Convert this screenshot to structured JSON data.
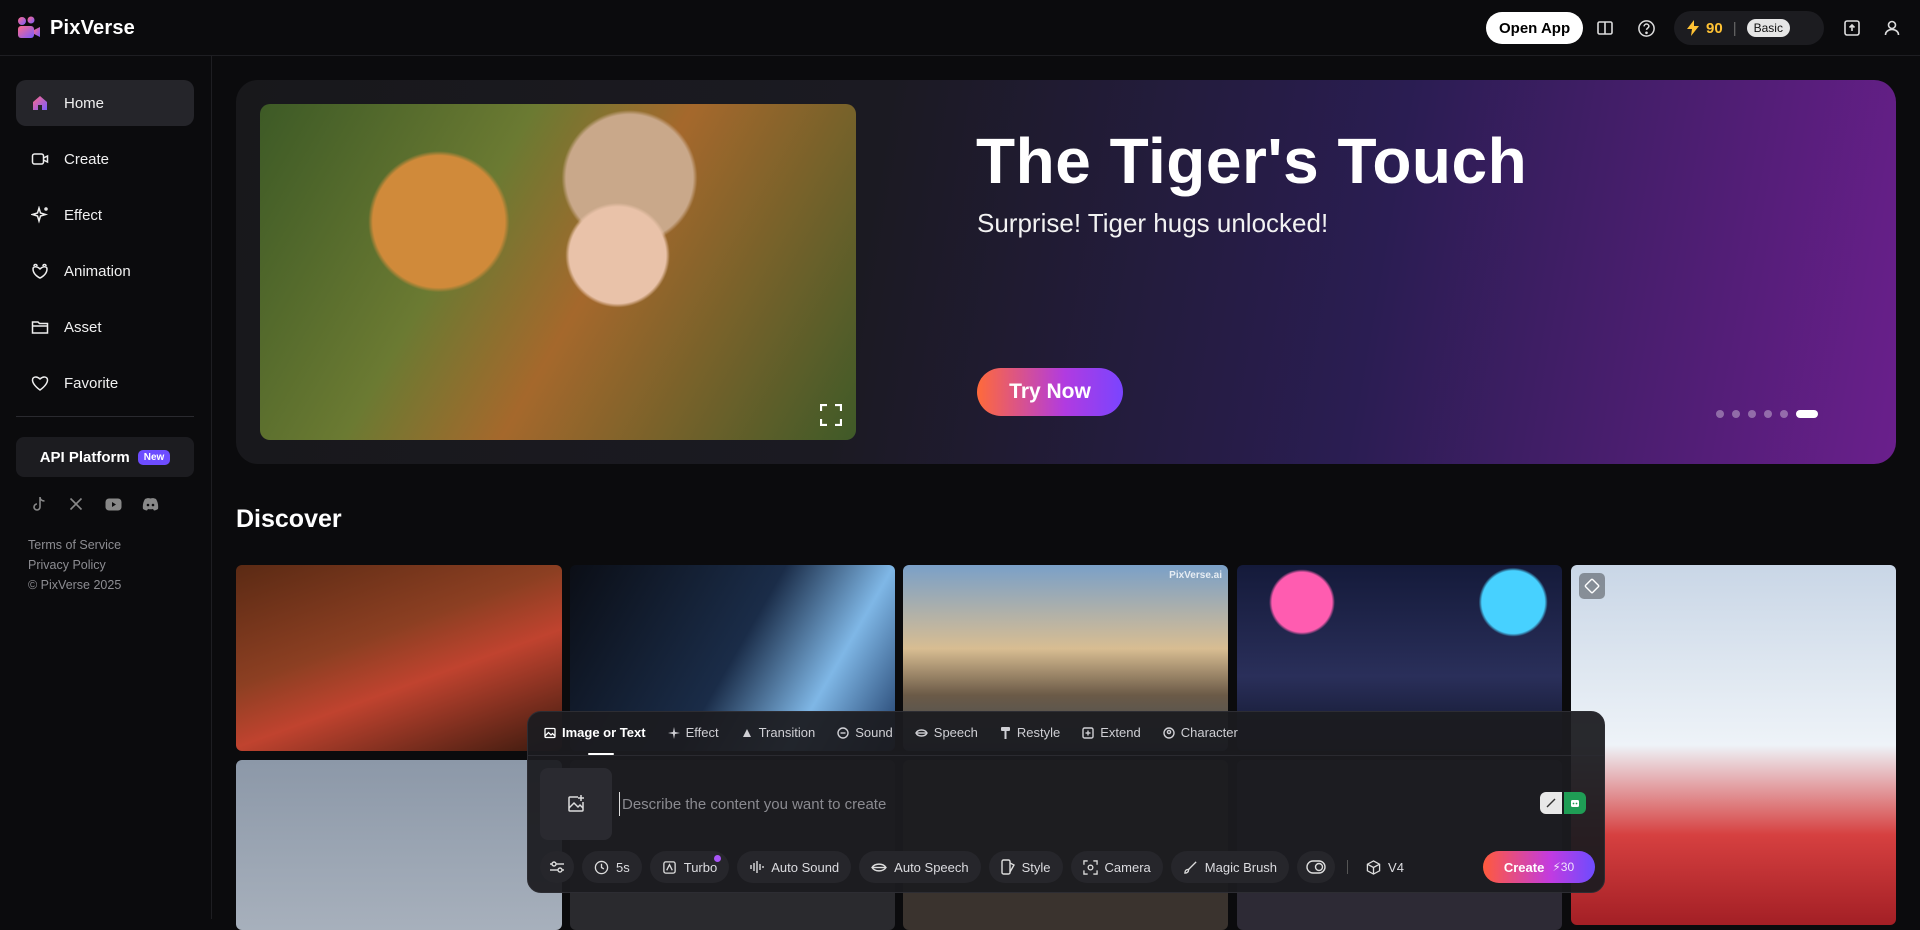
{
  "brand": {
    "name": "PixVerse"
  },
  "header": {
    "open_app_label": "Open App",
    "credits": "90",
    "plan": "Basic"
  },
  "sidebar": {
    "items": [
      {
        "label": "Home",
        "icon": "home-icon"
      },
      {
        "label": "Create",
        "icon": "video-camera-icon"
      },
      {
        "label": "Effect",
        "icon": "sparkle-icon"
      },
      {
        "label": "Animation",
        "icon": "animation-icon"
      },
      {
        "label": "Asset",
        "icon": "folder-icon"
      },
      {
        "label": "Favorite",
        "icon": "heart-icon"
      }
    ],
    "api_label": "API Platform",
    "api_badge": "New",
    "legal": [
      "Terms of Service",
      "Privacy Policy",
      "© PixVerse 2025"
    ]
  },
  "banner": {
    "title": "The Tiger's Touch",
    "subtitle": "Surprise! Tiger hugs unlocked!",
    "cta": "Try Now",
    "slide_count": 6,
    "active_slide": 6
  },
  "discover": {
    "title": "Discover",
    "watermarks": [
      "PixVerse.ai",
      "PixVerse.ai"
    ]
  },
  "create_panel": {
    "tabs": [
      "Image or Text",
      "Effect",
      "Transition",
      "Sound",
      "Speech",
      "Restyle",
      "Extend",
      "Character"
    ],
    "prompt_placeholder": "Describe the content you want to create",
    "duration": "5s",
    "turbo": "Turbo",
    "auto_sound": "Auto Sound",
    "auto_speech": "Auto Speech",
    "style": "Style",
    "camera": "Camera",
    "magic_brush": "Magic Brush",
    "model": "V4",
    "create_label": "Create",
    "create_cost": "30"
  },
  "colors": {
    "accent_start": "#ff5a3c",
    "accent_end": "#6d4cff",
    "credit": "#ffc234"
  }
}
